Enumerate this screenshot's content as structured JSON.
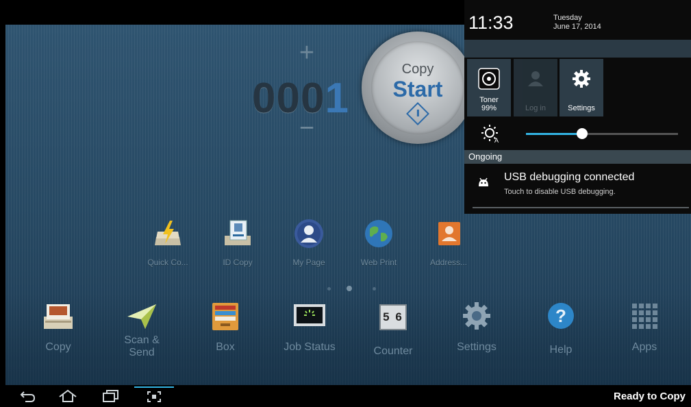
{
  "status_panel": {
    "time": "11:33",
    "day": "Tuesday",
    "date": "June 17, 2014",
    "toner_label": "Toner",
    "toner_value": "99%",
    "login_label": "Log in",
    "settings_label": "Settings",
    "brightness_level": 0.37,
    "ongoing_label": "Ongoing",
    "notification_title": "USB debugging connected",
    "notification_subtitle": "Touch to disable USB debugging."
  },
  "counter": {
    "prefix": "000",
    "digit": "1",
    "plus": "+",
    "minus": "−"
  },
  "start_button": {
    "label_top": "Copy",
    "label_main": "Start"
  },
  "favorites": [
    {
      "label": "Quick Co...",
      "icon": "quick-copy-icon"
    },
    {
      "label": "ID Copy",
      "icon": "id-copy-icon"
    },
    {
      "label": "My Page",
      "icon": "my-page-icon"
    },
    {
      "label": "Web Print",
      "icon": "web-print-icon"
    },
    {
      "label": "Address...",
      "icon": "address-book-icon"
    }
  ],
  "dock": [
    {
      "label": "Copy",
      "icon": "copy-icon"
    },
    {
      "label": "Scan &\nSend",
      "icon": "scan-send-icon"
    },
    {
      "label": "Box",
      "icon": "box-icon"
    },
    {
      "label": "Job Status",
      "icon": "job-status-icon"
    },
    {
      "label": "Counter",
      "icon": "counter-icon"
    },
    {
      "label": "Settings",
      "icon": "settings-icon"
    },
    {
      "label": "Help",
      "icon": "help-icon"
    },
    {
      "label": "Apps",
      "icon": "apps-icon"
    }
  ],
  "counter_icon_text": "5 6",
  "navbar": {
    "status": "Ready to Copy"
  },
  "colors": {
    "accent": "#33b5e5",
    "start_blue": "#2c6aa8",
    "background": "#2a4d68"
  }
}
